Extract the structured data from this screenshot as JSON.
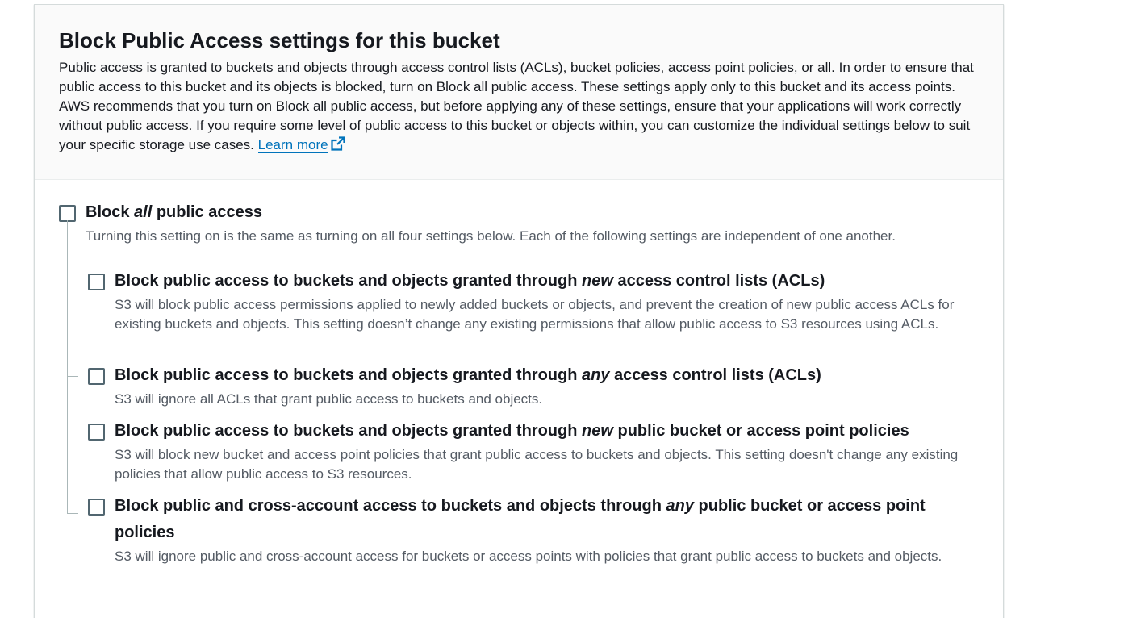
{
  "section": {
    "title": "Block Public Access settings for this bucket",
    "description": "Public access is granted to buckets and objects through access control lists (ACLs), bucket policies, access point policies, or all. In order to ensure that public access to this bucket and its objects is blocked, turn on Block all public access. These settings apply only to this bucket and its access points. AWS recommends that you turn on Block all public access, but before applying any of these settings, ensure that your applications will work correctly without public access. If you require some level of public access to this bucket or objects within, you can customize the individual settings below to suit your specific storage use cases.",
    "learn_more": "Learn more",
    "external_icon": "external-link-icon"
  },
  "block_all": {
    "label_pre": "Block ",
    "label_em": "all",
    "label_post": " public access",
    "description": "Turning this setting on is the same as turning on all four settings below. Each of the following settings are independent of one another.",
    "checked": false
  },
  "options": [
    {
      "label_pre": "Block public access to buckets and objects granted through ",
      "label_em": "new",
      "label_post": " access control lists (ACLs)",
      "description": "S3 will block public access permissions applied to newly added buckets or objects, and prevent the creation of new public access ACLs for existing buckets and objects. This setting doesn’t change any existing permissions that allow public access to S3 resources using ACLs.",
      "checked": false
    },
    {
      "label_pre": "Block public access to buckets and objects granted through ",
      "label_em": "any",
      "label_post": " access control lists (ACLs)",
      "description": "S3 will ignore all ACLs that grant public access to buckets and objects.",
      "checked": false
    },
    {
      "label_pre": "Block public access to buckets and objects granted through ",
      "label_em": "new",
      "label_post": " public bucket or access point policies",
      "description": "S3 will block new bucket and access point policies that grant public access to buckets and objects. This setting doesn't change any existing policies that allow public access to S3 resources.",
      "checked": false
    },
    {
      "label_pre": "Block public and cross-account access to buckets and objects through ",
      "label_em": "any",
      "label_post": " public bucket or access point policies",
      "description": "S3 will ignore public and cross-account access for buckets or access points with policies that grant public access to buckets and objects.",
      "checked": false
    }
  ],
  "colors": {
    "link": "#0073bb",
    "text": "#16191f",
    "secondary_text": "#545b64",
    "checkbox_border": "#516670"
  }
}
